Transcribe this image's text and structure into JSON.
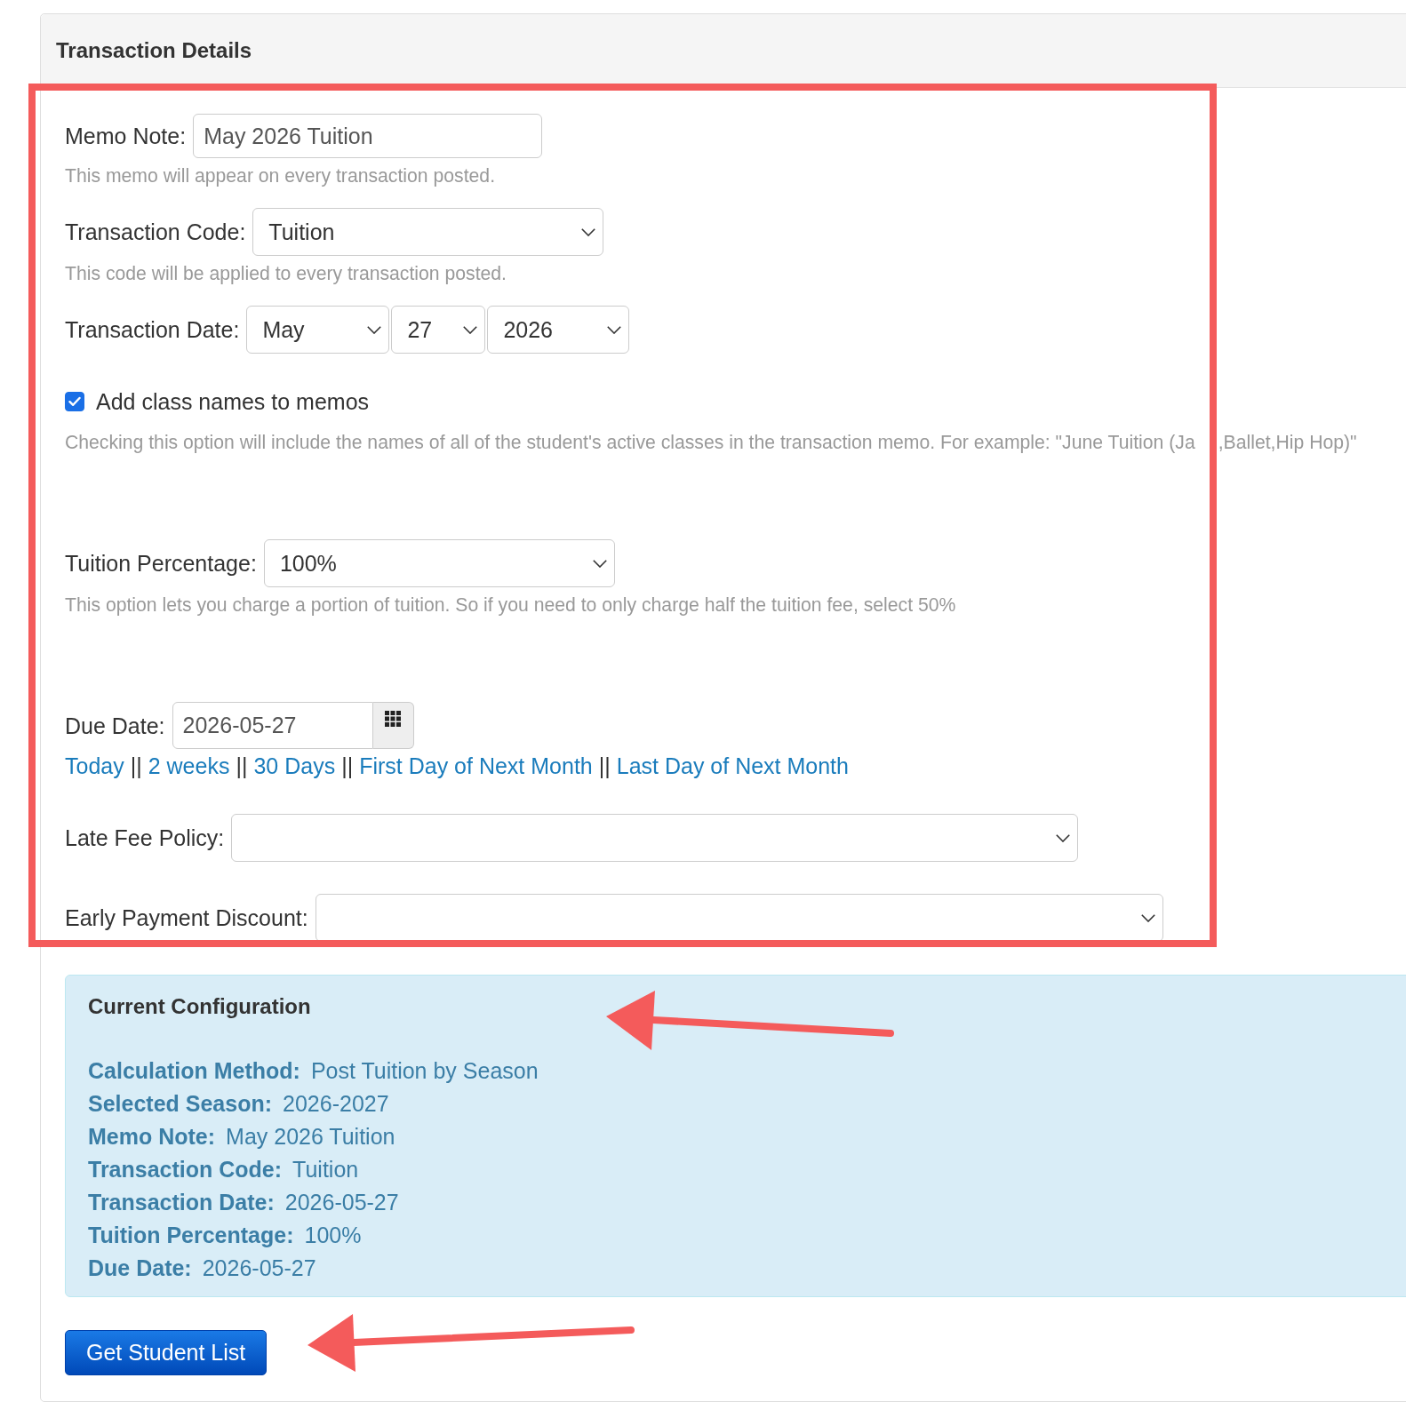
{
  "panel": {
    "title": "Transaction Details"
  },
  "fields": [
    {
      "kind": "text",
      "label": "Memo Note:",
      "value": "May 2026 Tuition",
      "help": [
        "This memo will appear on every transaction posted."
      ]
    },
    {
      "kind": "select",
      "label": "Transaction Code:",
      "value": "Tuition",
      "help": [
        "This code will be applied to every transaction posted."
      ]
    },
    {
      "kind": "date_selects",
      "label": "Transaction Date:",
      "parts": [
        "May",
        "27",
        "2026"
      ]
    },
    {
      "kind": "checkbox",
      "label": "Add class names to memos",
      "checked": true,
      "help": [
        "Checking this option will include the names of all of the student's active classes in the transaction memo. For example: \"June Tuition (Ja",
        ",Ballet,Hip Hop)\""
      ]
    },
    {
      "kind": "select",
      "label": "Tuition Percentage:",
      "value": "100%",
      "help": [
        "This option lets you charge a portion of tuition. So if you need to only charge half the tuition fee, select 50%"
      ]
    },
    {
      "kind": "date_picker",
      "label": "Due Date:",
      "value": "2026-05-27",
      "shortcuts": [
        {
          "kind": "link",
          "text": "Today"
        },
        {
          "kind": "separator",
          "text": "||"
        },
        {
          "kind": "link",
          "text": "2 weeks"
        },
        {
          "kind": "separator",
          "text": "||"
        },
        {
          "kind": "link",
          "text": "30 Days"
        },
        {
          "kind": "separator",
          "text": "||"
        },
        {
          "kind": "link",
          "text": "First Day of Next Month"
        },
        {
          "kind": "separator",
          "text": "||"
        },
        {
          "kind": "link",
          "text": "Last Day of Next Month"
        }
      ]
    },
    {
      "kind": "select",
      "label": "Late Fee Policy:"
    },
    {
      "kind": "select",
      "label": "Early Payment Discount:"
    }
  ],
  "configuration": {
    "title": "Current Configuration",
    "items": [
      {
        "label": "Calculation Method:",
        "value": "Post Tuition by Season"
      },
      {
        "label": "Selected Season:",
        "value": "2026-2027"
      },
      {
        "label": "Memo Note:",
        "value": "May 2026 Tuition"
      },
      {
        "label": "Transaction Code:",
        "value": "Tuition"
      },
      {
        "label": "Transaction Date:",
        "value": "2026-05-27"
      },
      {
        "label": "Tuition Percentage:",
        "value": "100%"
      },
      {
        "label": "Due Date:",
        "value": "2026-05-27"
      }
    ]
  },
  "actions": [
    {
      "label": "Get Student List"
    }
  ],
  "annotations": [
    {
      "kind": "frame"
    },
    {
      "kind": "arrow"
    },
    {
      "kind": "arrow"
    }
  ]
}
